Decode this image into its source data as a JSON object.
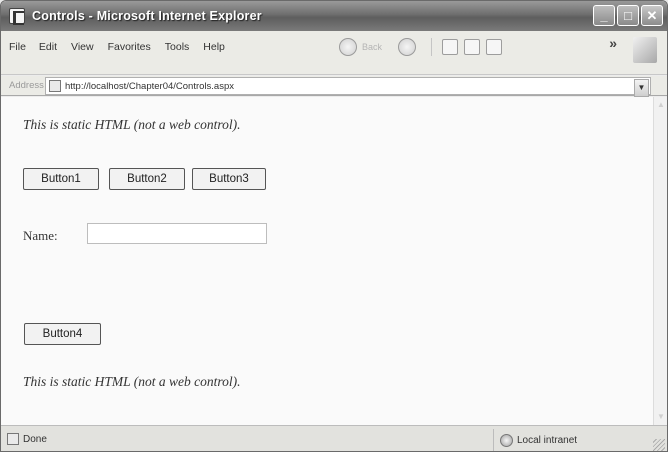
{
  "window": {
    "title": "Controls - Microsoft Internet Explorer",
    "minimize_glyph": "_",
    "maximize_glyph": "□",
    "close_glyph": "✕"
  },
  "menu": {
    "items": [
      "File",
      "Edit",
      "View",
      "Favorites",
      "Tools",
      "Help"
    ]
  },
  "toolbar": {
    "back_label": "Back",
    "icons": [
      "back-icon",
      "forward-icon",
      "stop-icon",
      "refresh-icon",
      "home-icon"
    ]
  },
  "address": {
    "label": "Address",
    "url": "http://localhost/Chapter04/Controls.aspx"
  },
  "page": {
    "static_text_top": "This is static HTML (not a web control).",
    "buttons_row": [
      "Button1",
      "Button2",
      "Button3"
    ],
    "name_label": "Name:",
    "name_value": "",
    "button4": "Button4",
    "static_text_bottom": "This is static HTML (not a web control)."
  },
  "status": {
    "text": "Done",
    "zone": "Local intranet"
  }
}
